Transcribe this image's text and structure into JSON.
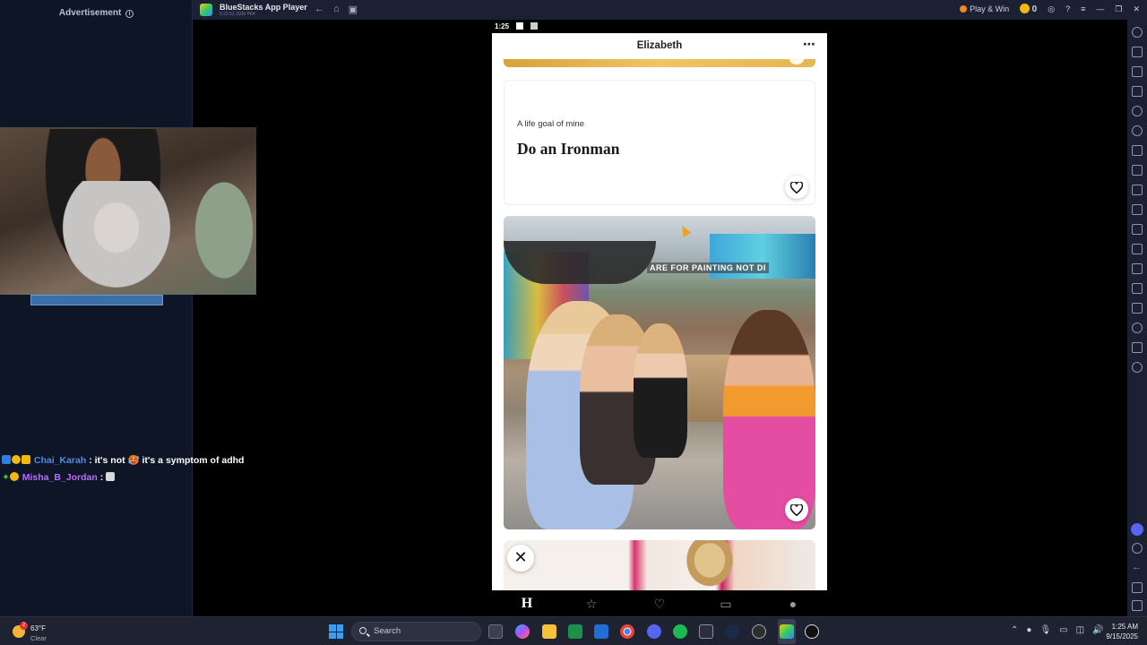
{
  "left_panel": {
    "advertisement_label": "Advertisement",
    "chat": [
      {
        "user": "Chai_Karah",
        "message": ": it's not 🥵 it's a symptom of adhd"
      },
      {
        "user": "Misha_B_Jordan",
        "message": ":"
      }
    ]
  },
  "titlebar": {
    "app_name": "BlueStacks App Player",
    "version": "5.22.51.1036 P64",
    "play_win": "Play & Win",
    "coins": "0"
  },
  "phone": {
    "status_time": "1:25",
    "profile_name": "Elizabeth",
    "more_icon": "⋯",
    "prompt": {
      "question": "A life goal of mine",
      "answer": "Do an Ironman"
    },
    "photo_sign_text": "ARE FOR PAINTING NOT DI",
    "close_icon": "✕",
    "nav": {
      "home": "H",
      "star": "☆",
      "likes": "♡",
      "messages": "▭",
      "profile": "●"
    }
  },
  "taskbar": {
    "weather_temp": "63°F",
    "weather_cond": "Clear",
    "weather_alert": "2",
    "search_placeholder": "Search",
    "time": "1:25 AM",
    "date": "9/15/2025"
  },
  "colors": {
    "accent_blue": "#3c9df0",
    "bluestacks_bar": "#1b2033",
    "chat_user1": "#4f8de8",
    "chat_user2": "#b86bff"
  }
}
